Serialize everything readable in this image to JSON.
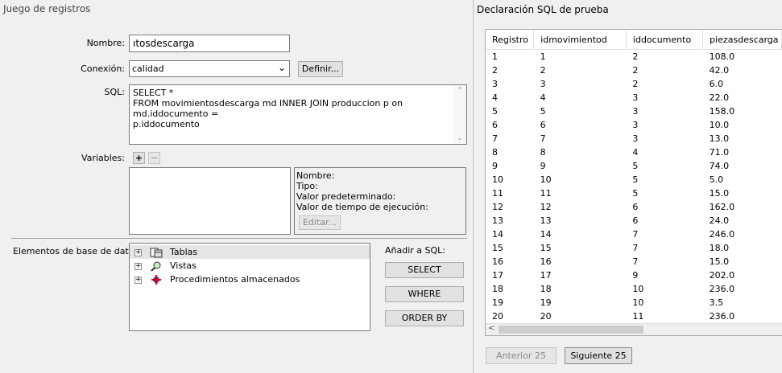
{
  "left": {
    "title": "Juego de registros",
    "labels": {
      "nombre": "Nombre:",
      "conexion": "Conexión:",
      "sql": "SQL:",
      "variables": "Variables:",
      "elementos": "Elementos de base de datos:",
      "anadir": "Añadir a SQL:"
    },
    "nombre_value": "ıtosdescarga",
    "conexion_value": "calidad",
    "definir_label": "Definir...",
    "sql_lines": [
      "SELECT *",
      "FROM movimientosdescarga md INNER JOIN produccion p on md.iddocumento =",
      "p.iddocumento"
    ],
    "var_details": {
      "nombre": "Nombre:",
      "tipo": "Tipo:",
      "valor_pred": "Valor predeterminado:",
      "valor_tiempo": "Valor de tiempo de ejecución:",
      "editar": "Editar..."
    },
    "tree": [
      "Tablas",
      "Vistas",
      "Procedimientos almacenados"
    ],
    "sql_buttons": [
      "SELECT",
      "WHERE",
      "ORDER BY"
    ],
    "plus": "+",
    "minus": "−"
  },
  "right": {
    "title": "Declaración SQL de prueba",
    "columns": [
      "Registro",
      "idmovimientod",
      "iddocumento",
      "piezasdescarga"
    ],
    "rows": [
      [
        "1",
        "1",
        "2",
        "108.0"
      ],
      [
        "2",
        "2",
        "2",
        "42.0"
      ],
      [
        "3",
        "3",
        "2",
        "6.0"
      ],
      [
        "4",
        "4",
        "3",
        "22.0"
      ],
      [
        "5",
        "5",
        "3",
        "158.0"
      ],
      [
        "6",
        "6",
        "3",
        "10.0"
      ],
      [
        "7",
        "7",
        "3",
        "13.0"
      ],
      [
        "8",
        "8",
        "4",
        "71.0"
      ],
      [
        "9",
        "9",
        "5",
        "74.0"
      ],
      [
        "10",
        "10",
        "5",
        "5.0"
      ],
      [
        "11",
        "11",
        "5",
        "15.0"
      ],
      [
        "12",
        "12",
        "6",
        "162.0"
      ],
      [
        "13",
        "13",
        "6",
        "24.0"
      ],
      [
        "14",
        "14",
        "7",
        "246.0"
      ],
      [
        "15",
        "15",
        "7",
        "18.0"
      ],
      [
        "16",
        "16",
        "7",
        "15.0"
      ],
      [
        "17",
        "17",
        "9",
        "202.0"
      ],
      [
        "18",
        "18",
        "10",
        "236.0"
      ],
      [
        "19",
        "19",
        "10",
        "3.5"
      ],
      [
        "20",
        "20",
        "11",
        "236.0"
      ]
    ],
    "prev_label": "Anterior 25",
    "next_label": "Siguiente 25",
    "scroll_left_glyph": "<"
  }
}
